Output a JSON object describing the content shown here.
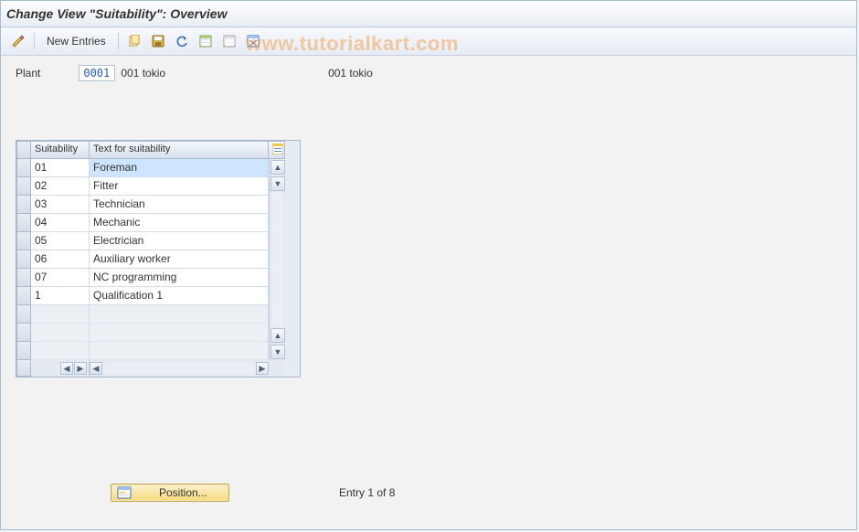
{
  "title": "Change View \"Suitability\": Overview",
  "watermark": "www.tutorialkart.com",
  "toolbar": {
    "new_entries_label": "New Entries",
    "icons": {
      "toggle": "change-display-toggle-icon",
      "copy": "copy-icon",
      "save": "save-icon",
      "undo": "undo-icon",
      "select_all": "select-all-icon",
      "deselect_all": "deselect-all-icon",
      "delete": "delete-icon"
    }
  },
  "field": {
    "label": "Plant",
    "value": "0001",
    "desc1": "001 tokio",
    "desc2": "001 tokio"
  },
  "table": {
    "columns": {
      "code": "Suitability",
      "text": "Text for suitability"
    },
    "rows": [
      {
        "code": "01",
        "text": "Foreman"
      },
      {
        "code": "02",
        "text": "Fitter"
      },
      {
        "code": "03",
        "text": "Technician"
      },
      {
        "code": "04",
        "text": "Mechanic"
      },
      {
        "code": "05",
        "text": "Electrician"
      },
      {
        "code": "06",
        "text": "Auxiliary worker"
      },
      {
        "code": "07",
        "text": "NC programming"
      },
      {
        "code": "1",
        "text": "Qualification 1"
      }
    ],
    "empty_rows": 3,
    "selected_cell": {
      "row": 0,
      "col": "text"
    }
  },
  "footer": {
    "position_label": "Position...",
    "entry_status": "Entry 1 of 8"
  }
}
